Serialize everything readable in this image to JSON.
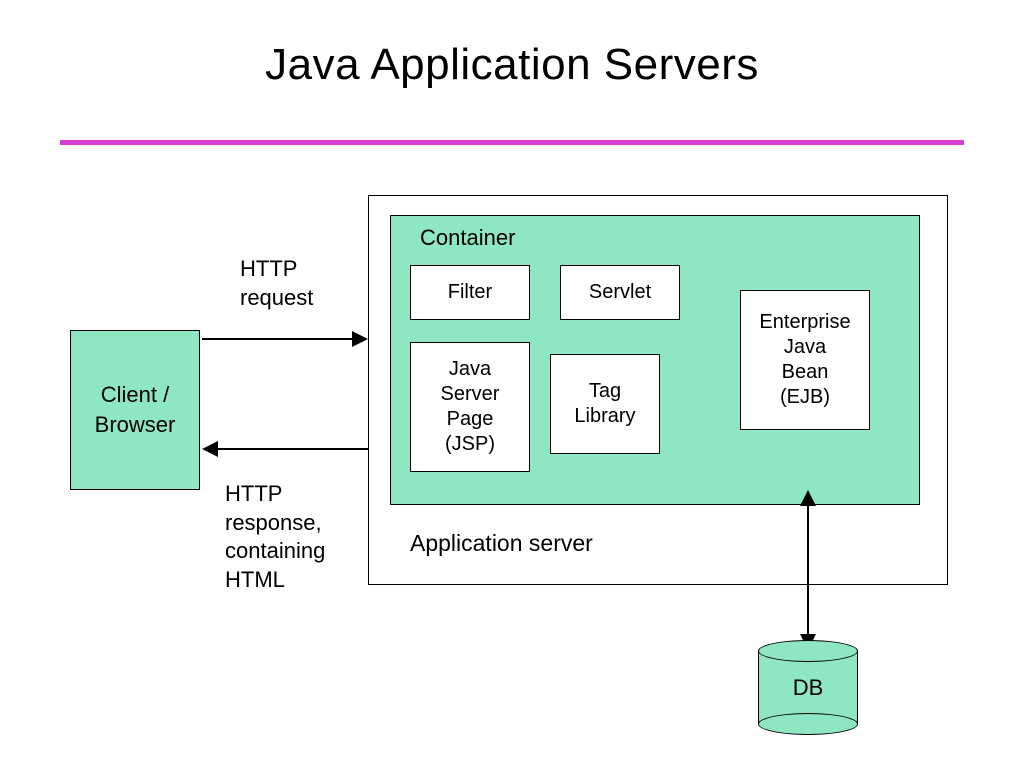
{
  "title": "Java Application Servers",
  "client_box": "Client / Browser",
  "request_label": "HTTP\nrequest",
  "response_label": "HTTP\nresponse,\ncontaining\nHTML",
  "appserver_label": "Application server",
  "container_label": "Container",
  "filter_label": "Filter",
  "servlet_label": "Servlet",
  "jsp_label": "Java\nServer\nPage\n(JSP)",
  "tag_label": "Tag\nLibrary",
  "ejb_label": "Enterprise\nJava\nBean\n(EJB)",
  "db_label": "DB",
  "colors": {
    "accent_green": "#8ee6c3",
    "rule_magenta": "#d63fd6"
  }
}
